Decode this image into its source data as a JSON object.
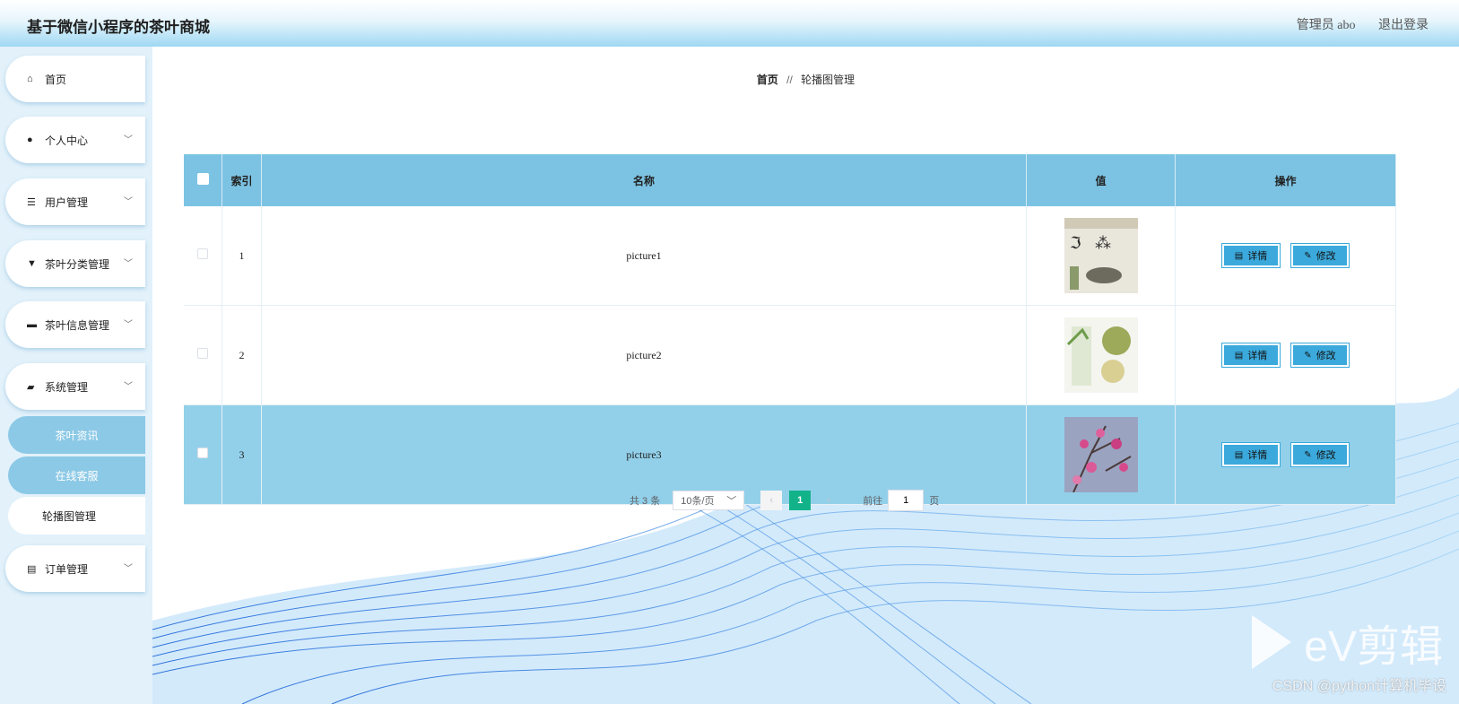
{
  "header": {
    "title": "基于微信小程序的茶叶商城",
    "user": "管理员 abo",
    "logout": "退出登录"
  },
  "sidebar": {
    "items": [
      {
        "label": "首页",
        "icon": "home-icon"
      },
      {
        "label": "个人中心",
        "icon": "user-icon"
      },
      {
        "label": "用户管理",
        "icon": "list-icon"
      },
      {
        "label": "茶叶分类管理",
        "icon": "category-icon"
      },
      {
        "label": "茶叶信息管理",
        "icon": "monitor-icon"
      },
      {
        "label": "系统管理",
        "icon": "ticket-icon"
      }
    ],
    "sub_items": [
      {
        "label": "茶叶资讯"
      },
      {
        "label": "在线客服"
      },
      {
        "label": "轮播图管理"
      }
    ],
    "order": {
      "label": "订单管理",
      "icon": "document-icon"
    }
  },
  "breadcrumb": {
    "home": "首页",
    "separator": "//",
    "current": "轮播图管理"
  },
  "table": {
    "columns": {
      "index": "索引",
      "name": "名称",
      "value": "值",
      "action": "操作"
    },
    "rows": [
      {
        "index": "1",
        "name": "picture1"
      },
      {
        "index": "2",
        "name": "picture2"
      },
      {
        "index": "3",
        "name": "picture3"
      }
    ],
    "detail_label": "详情",
    "edit_label": "修改"
  },
  "pagination": {
    "total": "共 3 条",
    "page_size": "10条/页",
    "current_page": "1",
    "goto_prefix": "前往",
    "goto_value": "1",
    "goto_suffix": "页"
  },
  "watermark": {
    "brand": "eV剪辑",
    "credit": "CSDN @python计算机毕设"
  },
  "colors": {
    "header_blue": "#9fd8f3",
    "table_header": "#7cc3e3",
    "button_blue": "#3ba9dc",
    "page_active": "#13b38a"
  }
}
